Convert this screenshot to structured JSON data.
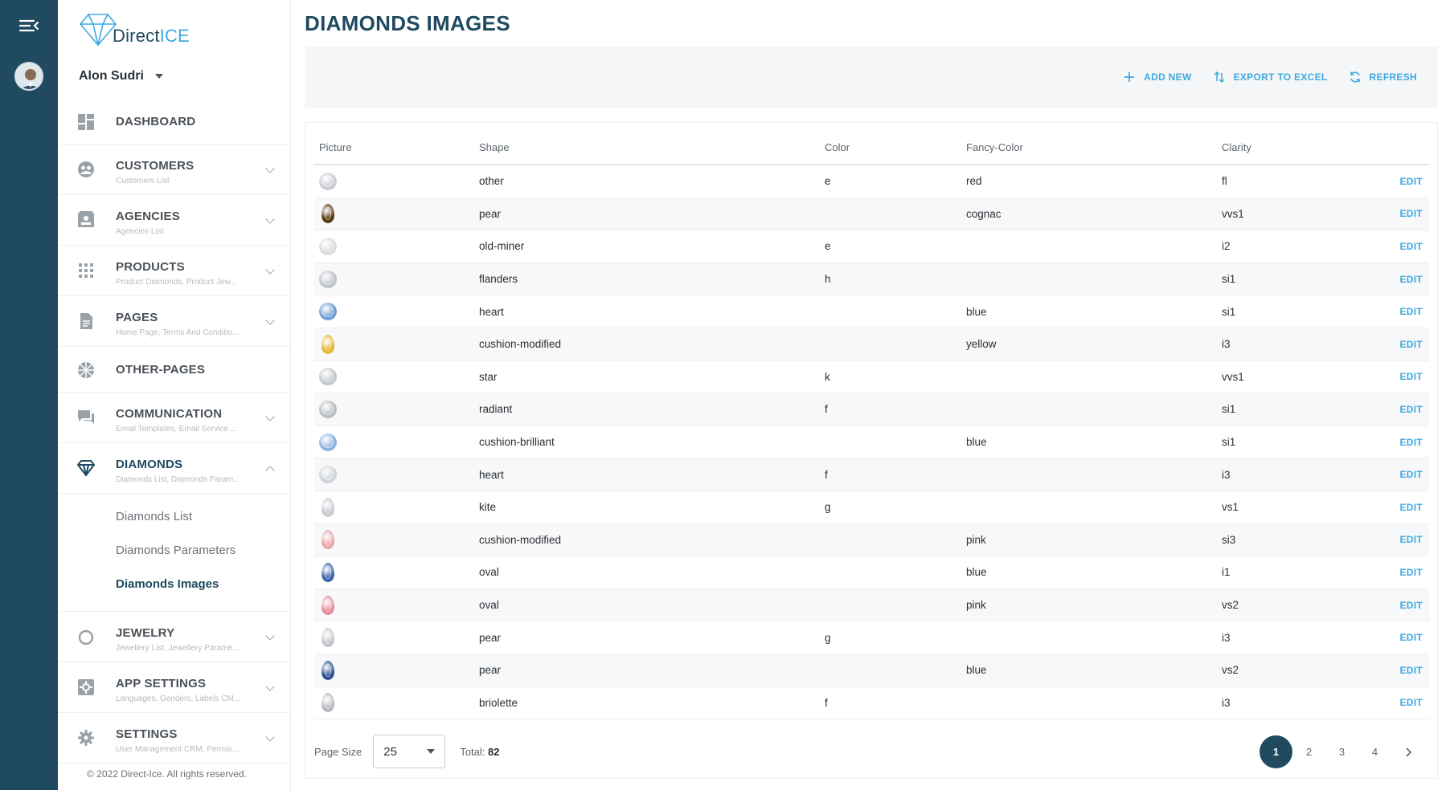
{
  "app": {
    "logo_text_a": "Direct",
    "logo_text_b": "ICE",
    "user_name": "Alon Sudri",
    "copyright": "© 2022 Direct-Ice. All rights reserved."
  },
  "sidebar": {
    "items": [
      {
        "title": "DASHBOARD",
        "sub": "",
        "icon": "dashboard-icon"
      },
      {
        "title": "CUSTOMERS",
        "sub": "Customers List",
        "icon": "customers-icon"
      },
      {
        "title": "AGENCIES",
        "sub": "Agencies List",
        "icon": "agencies-icon"
      },
      {
        "title": "PRODUCTS",
        "sub": "Product Diamonds, Product Jew...",
        "icon": "products-icon"
      },
      {
        "title": "PAGES",
        "sub": "Home Page, Terms And Conditio...",
        "icon": "pages-icon"
      },
      {
        "title": "OTHER-PAGES",
        "sub": "",
        "icon": "other-pages-icon"
      },
      {
        "title": "COMMUNICATION",
        "sub": "Email Templates, Email Service ...",
        "icon": "communication-icon"
      },
      {
        "title": "DIAMONDS",
        "sub": "Diamonds List, Diamonds Param...",
        "icon": "diamond-icon"
      },
      {
        "title": "JEWELRY",
        "sub": "Jewellery List, Jewellery Parame...",
        "icon": "jewelry-icon"
      },
      {
        "title": "APP SETTINGS",
        "sub": "Languages, Genders, Labels CM...",
        "icon": "app-settings-icon"
      },
      {
        "title": "SETTINGS",
        "sub": "User Management CRM, Permis...",
        "icon": "settings-icon"
      }
    ],
    "diamonds_sub": [
      "Diamonds List",
      "Diamonds Parameters",
      "Diamonds Images"
    ]
  },
  "main": {
    "title": "DIAMONDS IMAGES",
    "actions": {
      "add": "ADD NEW",
      "export": "EXPORT TO EXCEL",
      "refresh": "REFRESH"
    },
    "columns": [
      "Picture",
      "Shape",
      "Color",
      "Fancy-Color",
      "Clarity"
    ],
    "edit_label": "EDIT",
    "rows": [
      {
        "shape": "other",
        "color": "e",
        "fancy": "red",
        "clarity": "fl",
        "gem": "#c9cdd2"
      },
      {
        "shape": "pear",
        "color": "",
        "fancy": "cognac",
        "clarity": "vvs1",
        "gem": "#5a3a12"
      },
      {
        "shape": "old-miner",
        "color": "e",
        "fancy": "",
        "clarity": "i2",
        "gem": "#d8dbde"
      },
      {
        "shape": "flanders",
        "color": "h",
        "fancy": "",
        "clarity": "si1",
        "gem": "#bfc3c7"
      },
      {
        "shape": "heart",
        "color": "",
        "fancy": "blue",
        "clarity": "si1",
        "gem": "#6f9fd6"
      },
      {
        "shape": "cushion-modified",
        "color": "",
        "fancy": "yellow",
        "clarity": "i3",
        "gem": "#e4b634"
      },
      {
        "shape": "star",
        "color": "k",
        "fancy": "",
        "clarity": "vvs1",
        "gem": "#c4c8cc"
      },
      {
        "shape": "radiant",
        "color": "f",
        "fancy": "",
        "clarity": "si1",
        "gem": "#b9bdc1"
      },
      {
        "shape": "cushion-brilliant",
        "color": "",
        "fancy": "blue",
        "clarity": "si1",
        "gem": "#8fb3e0"
      },
      {
        "shape": "heart",
        "color": "f",
        "fancy": "",
        "clarity": "i3",
        "gem": "#d0d4d8"
      },
      {
        "shape": "kite",
        "color": "g",
        "fancy": "",
        "clarity": "vs1",
        "gem": "#c7cbcf"
      },
      {
        "shape": "cushion-modified",
        "color": "",
        "fancy": "pink",
        "clarity": "si3",
        "gem": "#eaa3a8"
      },
      {
        "shape": "oval",
        "color": "",
        "fancy": "blue",
        "clarity": "i1",
        "gem": "#3c64a8"
      },
      {
        "shape": "oval",
        "color": "",
        "fancy": "pink",
        "clarity": "vs2",
        "gem": "#e88a9a"
      },
      {
        "shape": "pear",
        "color": "g",
        "fancy": "",
        "clarity": "i3",
        "gem": "#c2c6ca"
      },
      {
        "shape": "pear",
        "color": "",
        "fancy": "blue",
        "clarity": "vs2",
        "gem": "#2f4f8f"
      },
      {
        "shape": "briolette",
        "color": "f",
        "fancy": "",
        "clarity": "i3",
        "gem": "#b7bbbf"
      }
    ],
    "pager": {
      "page_size_label": "Page Size",
      "page_size": "25",
      "total_label": "Total:",
      "total": "82",
      "pages": [
        "1",
        "2",
        "3",
        "4"
      ],
      "current": "1"
    }
  }
}
